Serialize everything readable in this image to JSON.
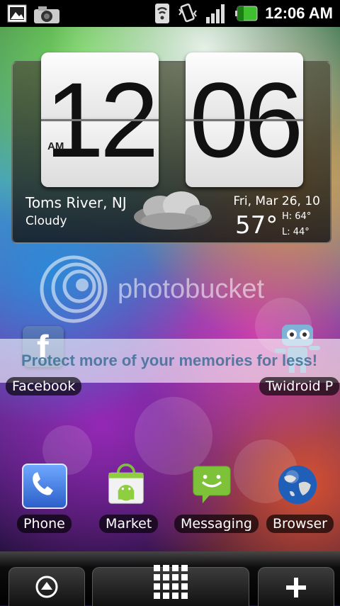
{
  "status_bar": {
    "time": "12:06 AM",
    "icons": [
      "gallery-notification-icon",
      "camera-notification-icon",
      "sync-icon",
      "vibrate-icon",
      "signal-icon",
      "battery-icon"
    ],
    "battery_color": "#3fbf2f"
  },
  "clock_widget": {
    "hours": "12",
    "minutes": "06",
    "ampm": "AM",
    "city": "Toms River, NJ",
    "condition": "Cloudy",
    "date": "Fri, Mar 26, 10",
    "temperature": "57°",
    "high": "H: 64°",
    "low": "L: 44°",
    "weather_icon": "cloudy-icon"
  },
  "watermark": {
    "brand": "photobucket",
    "banner": "Protect more of your memories for less!"
  },
  "shortcuts": [
    {
      "label": "Facebook",
      "icon": "facebook-icon"
    },
    {
      "label": "Twidroid P",
      "icon": "twidroid-robot-icon"
    }
  ],
  "dock": [
    {
      "label": "Phone",
      "icon": "phone-icon"
    },
    {
      "label": "Market",
      "icon": "market-icon"
    },
    {
      "label": "Messaging",
      "icon": "messaging-icon"
    },
    {
      "label": "Browser",
      "icon": "browser-globe-icon"
    }
  ],
  "bottom_bar": {
    "left": "up-arrow-icon",
    "center": "app-grid-icon",
    "right": "plus-icon"
  }
}
